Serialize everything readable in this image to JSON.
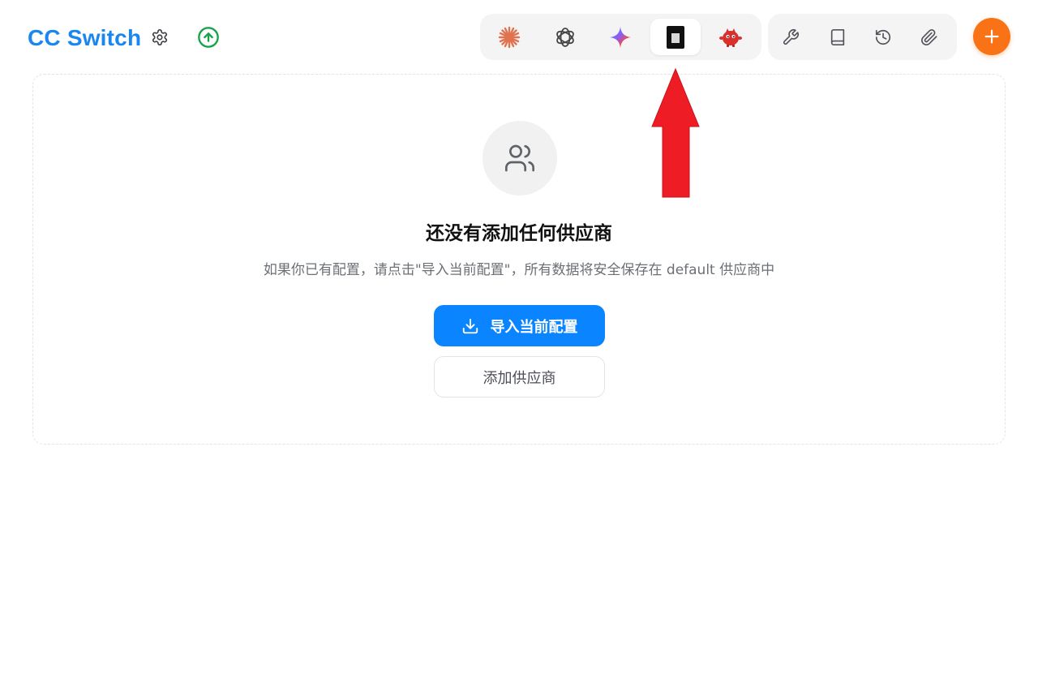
{
  "header": {
    "title": "CC Switch"
  },
  "app_switcher": {
    "active_index": 3,
    "items": [
      {
        "name": "claude",
        "icon": "claude-starburst-icon",
        "color": "#e0734f"
      },
      {
        "name": "openai",
        "icon": "openai-knot-icon",
        "color": "#444444"
      },
      {
        "name": "gemini",
        "icon": "gemini-sparkle-icon",
        "color": "#4a8cff"
      },
      {
        "name": "terminal",
        "icon": "dark-block-icon",
        "color": "#111111"
      },
      {
        "name": "mascot",
        "icon": "red-mascot-icon",
        "color": "#d9302c"
      }
    ]
  },
  "toolbar": {
    "items": [
      "wrench-icon",
      "book-icon",
      "history-icon",
      "paperclip-icon"
    ]
  },
  "empty_state": {
    "title": "还没有添加任何供应商",
    "description": "如果你已有配置，请点击\"导入当前配置\"，所有数据将安全保存在 default 供应商中",
    "import_label": "导入当前配置",
    "add_label": "添加供应商"
  },
  "colors": {
    "brand": "#1a86f0",
    "primary": "#0a84ff",
    "accent": "#f97316",
    "update": "#16a34a",
    "annotation": "#ee1c25"
  }
}
